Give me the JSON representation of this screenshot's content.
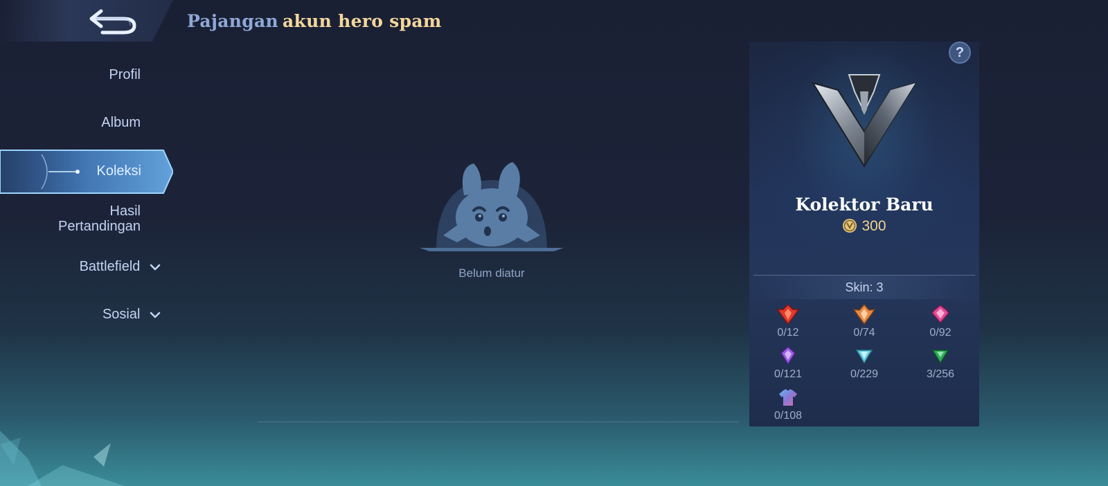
{
  "header": {
    "back_icon": "back-arrow-icon",
    "title_part1": "Pajangan",
    "title_part2": "akun hero spam",
    "title_color_1": "#8fa8d6",
    "title_color_2": "#f3d79c"
  },
  "sidebar": {
    "items": [
      {
        "label": "Profil",
        "active": false
      },
      {
        "label": "Album",
        "active": false
      },
      {
        "label": "Koleksi",
        "active": true
      },
      {
        "label_line1": "Hasil",
        "label_line2": "Pertandingan",
        "active": false
      },
      {
        "label": "Battlefield",
        "has_dropdown": true,
        "icon": "chevron-down-icon"
      },
      {
        "label": "Sosial",
        "has_dropdown": true,
        "icon": "chevron-down-icon"
      }
    ]
  },
  "main": {
    "empty_icon": "surprised-mascot-icon",
    "empty_message": "Belum diatur"
  },
  "panel": {
    "help_icon": "question-mark-icon",
    "help_text": "?",
    "emblem_icon": "collector-rank-emblem-icon",
    "rank_name": "Kolektor Baru",
    "points_icon": "collection-coin-icon",
    "points": "300",
    "skin_label": "Skin: 3",
    "stats": [
      {
        "icon": "legend-gem-red-icon",
        "value": "0/12",
        "color": "#e0392e"
      },
      {
        "icon": "epic-gem-orange-icon",
        "value": "0/74",
        "color": "#e88a4a"
      },
      {
        "icon": "special-gem-pink-icon",
        "value": "0/92",
        "color": "#e24a94"
      },
      {
        "icon": "elite-gem-purple-icon",
        "value": "0/121",
        "color": "#9b5ce8"
      },
      {
        "icon": "normal-gem-cyan-icon",
        "value": "0/229",
        "color": "#6fd3e6"
      },
      {
        "icon": "basic-gem-green-icon",
        "value": "3/256",
        "color": "#2fae5a"
      },
      {
        "icon": "shirt-icon",
        "value": "0/108",
        "color": "#8a78d8"
      }
    ]
  }
}
